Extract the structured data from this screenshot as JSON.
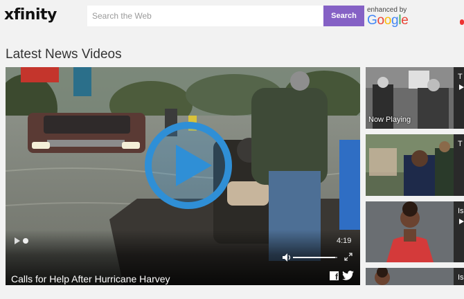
{
  "header": {
    "logo": "xfinity",
    "search": {
      "placeholder": "Search the Web",
      "value": ""
    },
    "search_button_label": "Search",
    "enhanced_by": "enhanced by",
    "google": [
      "G",
      "o",
      "o",
      "g",
      "l",
      "e"
    ]
  },
  "main": {
    "section_title": "Latest News Videos",
    "video": {
      "title": "Calls for Help After Hurricane Harvey",
      "duration": "4:19",
      "volume_fraction": 0.95,
      "progress_fraction": 0
    }
  },
  "sidebar": {
    "items": [
      {
        "label": "T",
        "badge": "Now Playing"
      },
      {
        "label": "T",
        "badge": ""
      },
      {
        "label": "Is",
        "badge": ""
      },
      {
        "label": "Is",
        "badge": ""
      }
    ]
  },
  "colors": {
    "accent": "#8561c5",
    "play_button": "#2f8fd6",
    "page_background": "#f2f2f2"
  },
  "icons": [
    "play-icon",
    "volume-icon",
    "fullscreen-icon",
    "facebook-icon",
    "twitter-icon"
  ]
}
